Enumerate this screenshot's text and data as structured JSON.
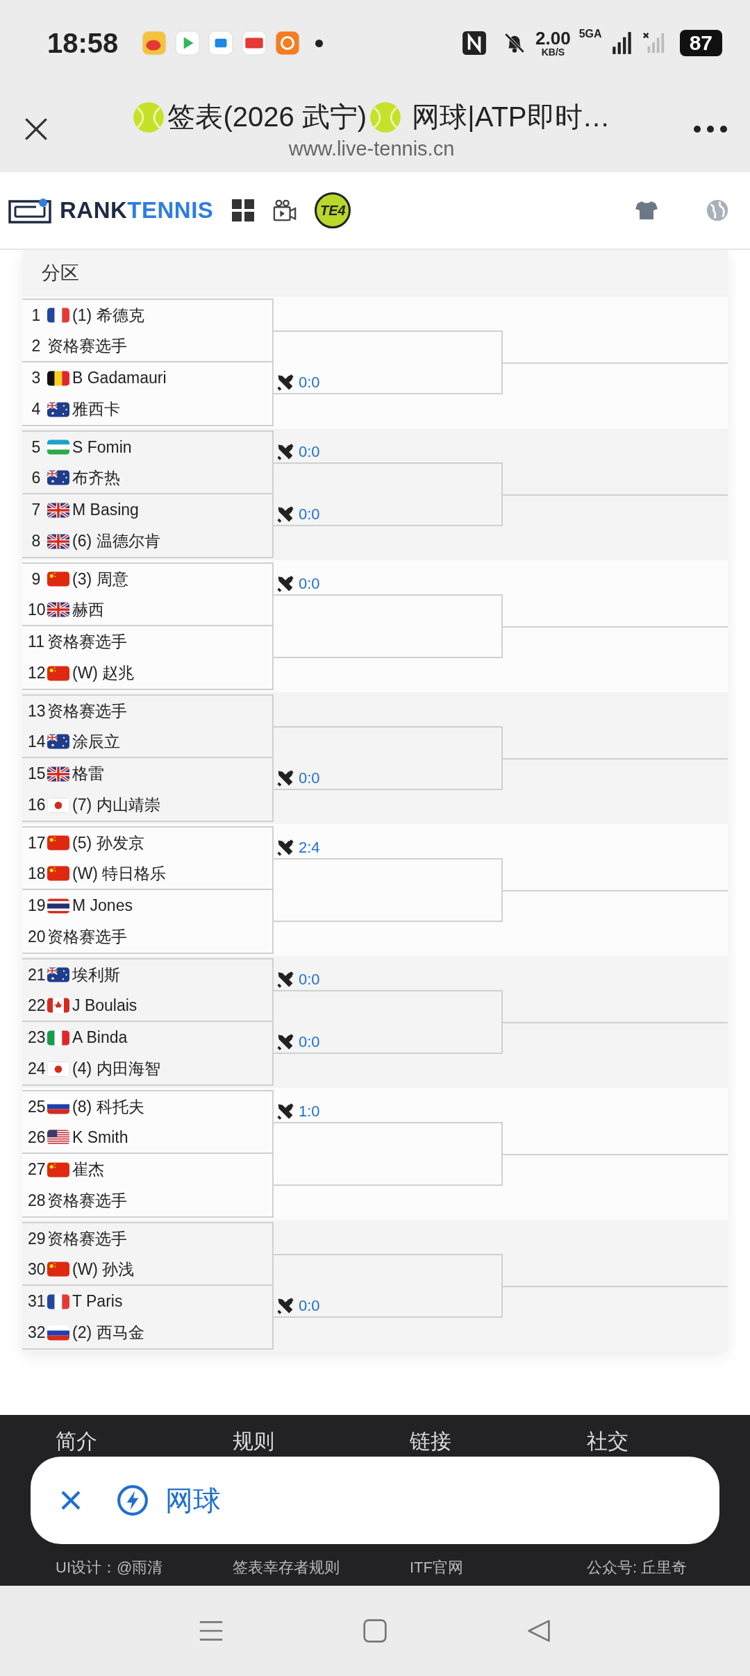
{
  "status_bar": {
    "time": "18:58",
    "net_speed": "2.00",
    "net_unit": "KB/S",
    "network": "5GA",
    "battery": "87"
  },
  "browser": {
    "title_part1": "签表(2026 武宁)",
    "title_part2": " 网球|ATP即时…",
    "url": "www.live-tennis.cn"
  },
  "site_header": {
    "logo_left": "RANK",
    "logo_right": "TENNIS",
    "badge": "TE4"
  },
  "draw": {
    "heading": "分区",
    "groups": [
      {
        "players": [
          {
            "no": "1",
            "kind": "fr",
            "name": "(1) 希德克"
          },
          {
            "no": "2",
            "kind": "qualifier",
            "name": "资格赛选手"
          },
          {
            "no": "3",
            "kind": "be",
            "name": "B Gadamauri"
          },
          {
            "no": "4",
            "kind": "au",
            "name": "雅西卡"
          }
        ],
        "score_2": "0:0"
      },
      {
        "players": [
          {
            "no": "5",
            "kind": "uz",
            "name": "S Fomin"
          },
          {
            "no": "6",
            "kind": "au",
            "name": "布齐热"
          },
          {
            "no": "7",
            "kind": "gb",
            "name": "M Basing"
          },
          {
            "no": "8",
            "kind": "gb",
            "name": "(6) 温德尔肯"
          }
        ],
        "score_1": "0:0",
        "score_2": "0:0"
      },
      {
        "players": [
          {
            "no": "9",
            "kind": "cn",
            "name": "(3) 周意"
          },
          {
            "no": "10",
            "kind": "gb",
            "name": "赫西"
          },
          {
            "no": "11",
            "kind": "qualifier",
            "name": "资格赛选手"
          },
          {
            "no": "12",
            "kind": "cn",
            "name": "(W) 赵兆"
          }
        ],
        "score_1": "0:0"
      },
      {
        "players": [
          {
            "no": "13",
            "kind": "qualifier",
            "name": "资格赛选手"
          },
          {
            "no": "14",
            "kind": "au",
            "name": "涂辰立"
          },
          {
            "no": "15",
            "kind": "gb",
            "name": "格雷"
          },
          {
            "no": "16",
            "kind": "jp",
            "name": "(7) 内山靖崇"
          }
        ],
        "score_2": "0:0"
      },
      {
        "players": [
          {
            "no": "17",
            "kind": "cn",
            "name": "(5) 孙发京"
          },
          {
            "no": "18",
            "kind": "cn",
            "name": "(W) 特日格乐"
          },
          {
            "no": "19",
            "kind": "th",
            "name": "M Jones"
          },
          {
            "no": "20",
            "kind": "qualifier",
            "name": "资格赛选手"
          }
        ],
        "score_1": "2:4"
      },
      {
        "players": [
          {
            "no": "21",
            "kind": "au",
            "name": "埃利斯"
          },
          {
            "no": "22",
            "kind": "ca",
            "name": "J Boulais"
          },
          {
            "no": "23",
            "kind": "it",
            "name": "A Binda"
          },
          {
            "no": "24",
            "kind": "jp",
            "name": "(4) 内田海智"
          }
        ],
        "score_1": "0:0",
        "score_2": "0:0"
      },
      {
        "players": [
          {
            "no": "25",
            "kind": "ru",
            "name": "(8) 科托夫"
          },
          {
            "no": "26",
            "kind": "us",
            "name": "K Smith"
          },
          {
            "no": "27",
            "kind": "cn",
            "name": "崔杰"
          },
          {
            "no": "28",
            "kind": "qualifier",
            "name": "资格赛选手"
          }
        ],
        "score_1": "1:0"
      },
      {
        "players": [
          {
            "no": "29",
            "kind": "qualifier",
            "name": "资格赛选手"
          },
          {
            "no": "30",
            "kind": "cn",
            "name": "(W) 孙浅"
          },
          {
            "no": "31",
            "kind": "fr",
            "name": "T Paris"
          },
          {
            "no": "32",
            "kind": "ru",
            "name": "(2) 西马金"
          }
        ],
        "score_2": "0:0"
      }
    ]
  },
  "footer": {
    "headings": [
      "简介",
      "规则",
      "链接",
      "社交"
    ],
    "links": [
      "UI设计：@雨清",
      "签表幸存者规则",
      "ITF官网",
      "公众号: 丘里奇"
    ]
  },
  "search_pill": {
    "query": "网球"
  }
}
